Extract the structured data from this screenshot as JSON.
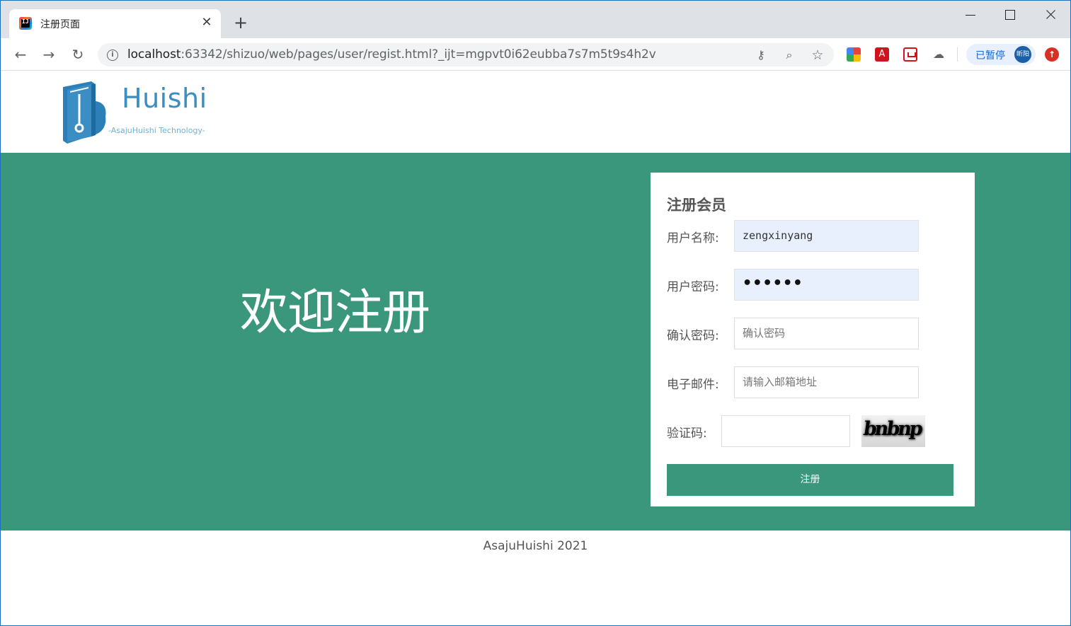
{
  "browser": {
    "tab_title": "注册页面",
    "tab_close_glyph": "✕",
    "new_tab_glyph": "+",
    "url_host": "localhost",
    "url_rest": ":63342/shizuo/web/pages/user/regist.html?_ijt=mgpvt0i62eubba7s7m5t9s4h2v",
    "profile_status": "已暂停",
    "profile_avatar": "昕阳",
    "icons": [
      "back-icon",
      "forward-icon",
      "reload-icon",
      "info-icon",
      "key-icon",
      "zoom-icon",
      "star-icon",
      "update-icon"
    ]
  },
  "header": {
    "logo_name": "Huishi",
    "logo_tagline": "-AsajuHuishi Technology-",
    "logo_color": "#3a8ec3"
  },
  "banner": {
    "welcome": "欢迎注册",
    "background": "#3a977b"
  },
  "form": {
    "title": "注册会员",
    "username_label": "用户名称:",
    "username_value": "zengxinyang",
    "password_label": "用户密码:",
    "password_value": "••••••",
    "confirm_label": "确认密码:",
    "confirm_placeholder": "确认密码",
    "email_label": "电子邮件:",
    "email_placeholder": "请输入邮箱地址",
    "captcha_label": "验证码:",
    "captcha_text": "bnbnp",
    "submit_label": "注册"
  },
  "footer": {
    "text": "AsajuHuishi 2021"
  }
}
